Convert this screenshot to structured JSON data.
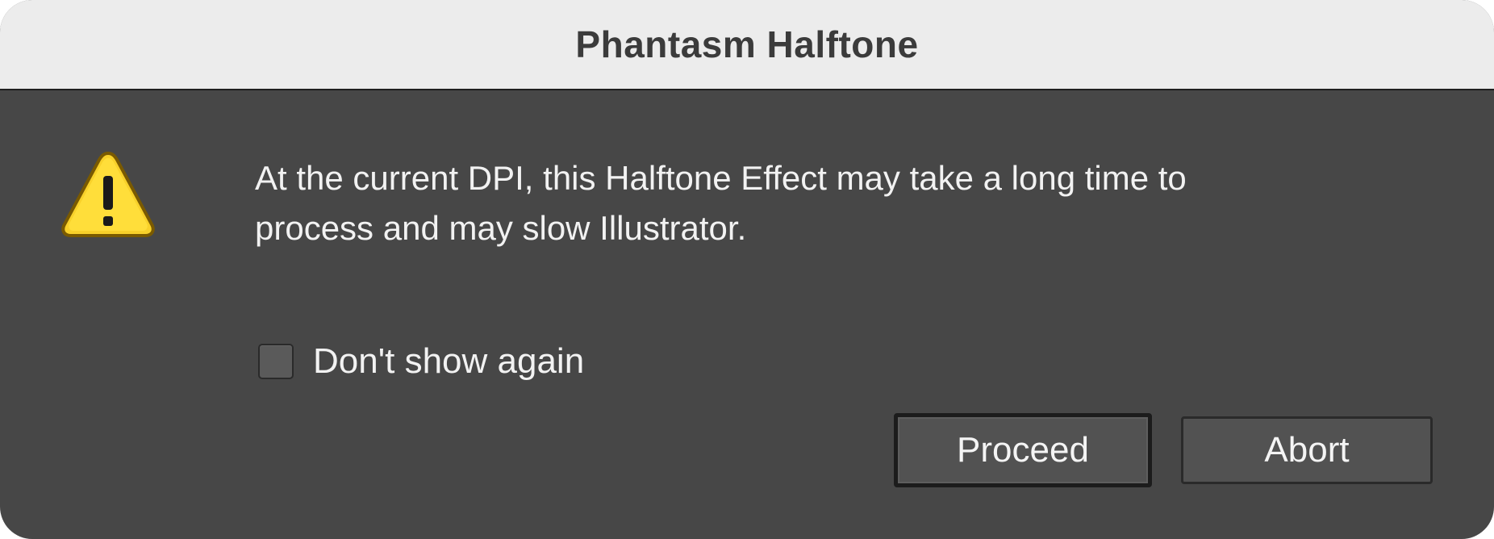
{
  "window": {
    "title": "Phantasm Halftone"
  },
  "alert": {
    "icon": "warning-triangle-icon",
    "icon_color": "#f8d12a",
    "message_lines": [
      "At the current DPI, this Halftone Effect may take a long time to",
      "process and may slow Illustrator."
    ]
  },
  "checkbox": {
    "label": "Don't show again",
    "checked": false
  },
  "buttons": {
    "proceed_label": "Proceed",
    "abort_label": "Abort",
    "default": "Proceed"
  },
  "colors": {
    "dialog_background": "#474747",
    "titlebar_background": "#ececec",
    "text": "#f2f2f2"
  }
}
